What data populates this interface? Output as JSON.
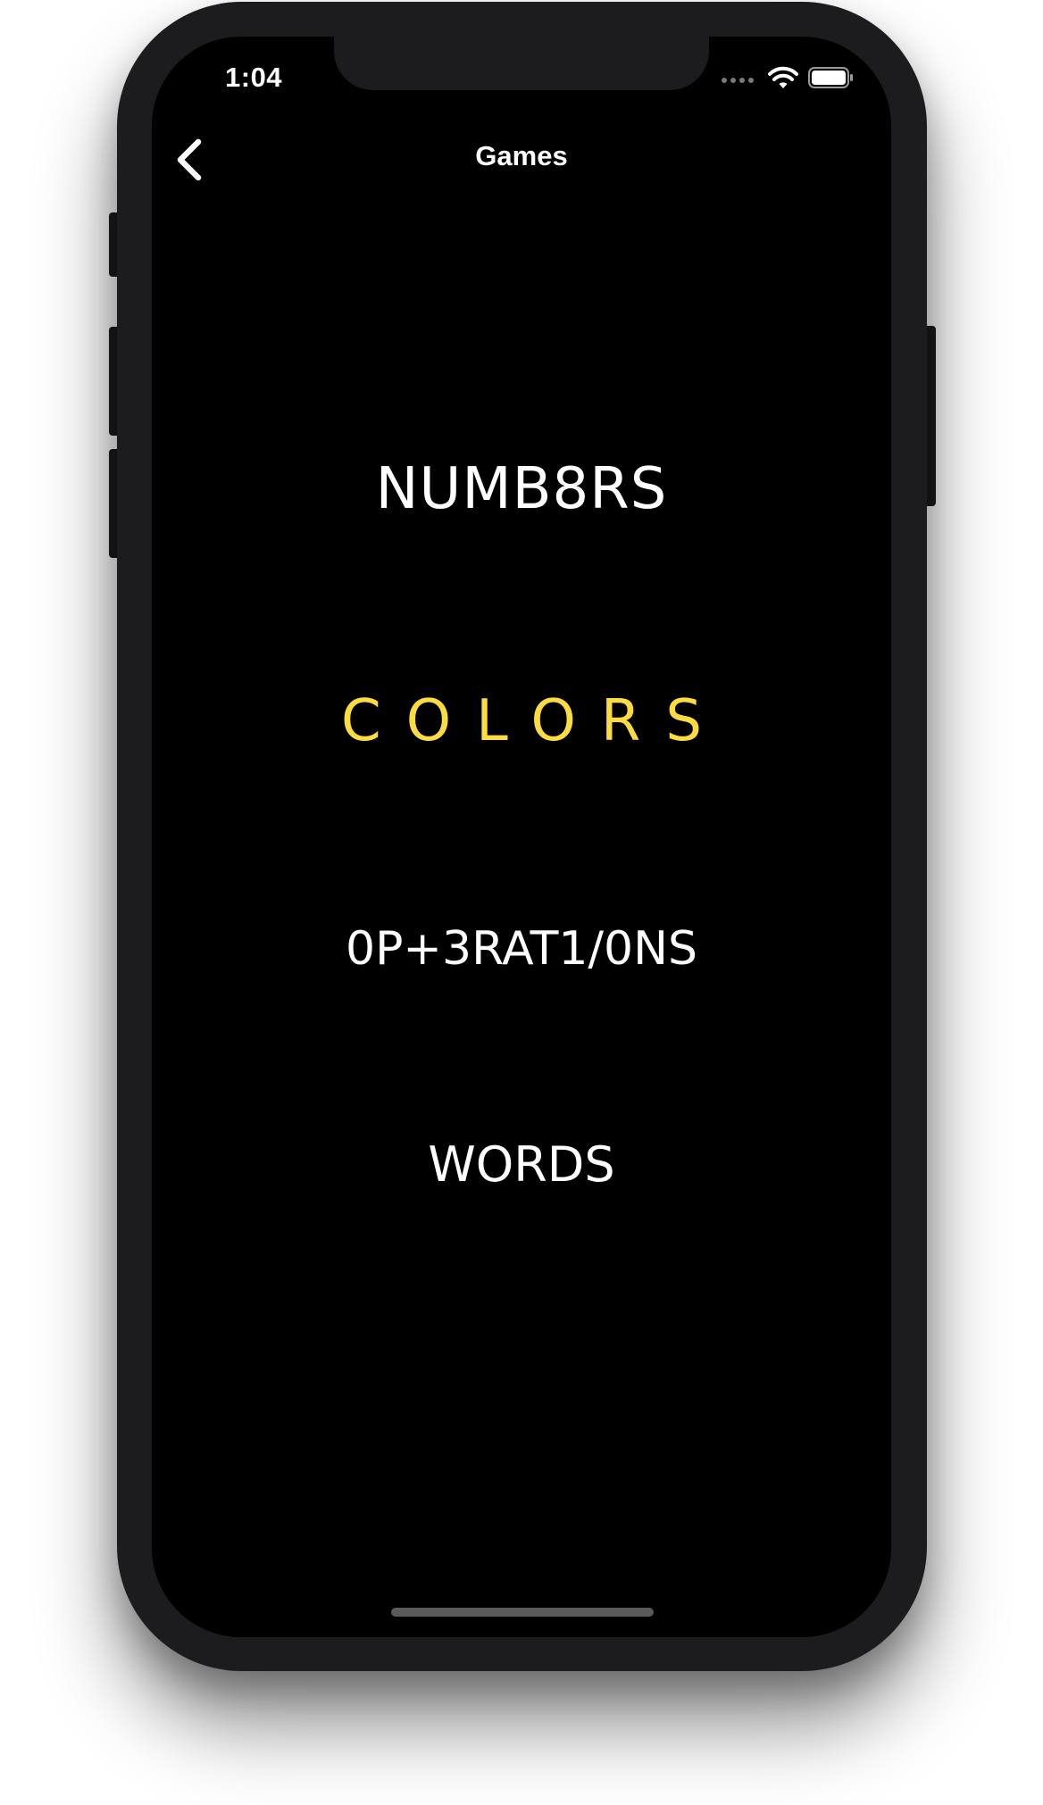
{
  "status_bar": {
    "time": "1:04",
    "icons": [
      "signal-icon",
      "wifi-icon",
      "battery-icon"
    ]
  },
  "nav": {
    "back_icon": "chevron-left-icon",
    "title": "Games"
  },
  "menu": {
    "items": [
      {
        "label": "NUMB8RS",
        "color": "#ffffff"
      },
      {
        "label": "COLORS",
        "color": "#fddc3f"
      },
      {
        "label": "0P+3RAT1/0NS",
        "color": "#ffffff"
      },
      {
        "label": "WORDS",
        "color": "#ffffff"
      }
    ]
  },
  "colors": {
    "background": "#000000",
    "text": "#ffffff",
    "accent_yellow": "#fddc3f"
  }
}
